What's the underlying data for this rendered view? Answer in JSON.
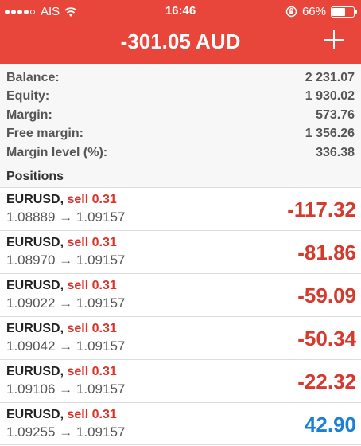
{
  "status_bar": {
    "carrier": "AIS",
    "time": "16:46",
    "battery": "66%",
    "battery_level": 0.66
  },
  "header": {
    "title": "-301.05 AUD",
    "add_icon": "plus-icon"
  },
  "summary": [
    {
      "label": "Balance:",
      "value": "2 231.07"
    },
    {
      "label": "Equity:",
      "value": "1 930.02"
    },
    {
      "label": "Margin:",
      "value": "573.76"
    },
    {
      "label": "Free margin:",
      "value": "1 356.26"
    },
    {
      "label": "Margin level (%):",
      "value": "336.38"
    }
  ],
  "positions_title": "Positions",
  "positions": [
    {
      "symbol": "EURUSD,",
      "type": "sell 0.31",
      "prices": "1.08889 → 1.09157",
      "profit": "-117.32",
      "color": "#d43b2f"
    },
    {
      "symbol": "EURUSD,",
      "type": "sell 0.31",
      "prices": "1.08970 → 1.09157",
      "profit": "-81.86",
      "color": "#d43b2f"
    },
    {
      "symbol": "EURUSD,",
      "type": "sell 0.31",
      "prices": "1.09022 → 1.09157",
      "profit": "-59.09",
      "color": "#d43b2f"
    },
    {
      "symbol": "EURUSD,",
      "type": "sell 0.31",
      "prices": "1.09042 → 1.09157",
      "profit": "-50.34",
      "color": "#d43b2f"
    },
    {
      "symbol": "EURUSD,",
      "type": "sell 0.31",
      "prices": "1.09106 → 1.09157",
      "profit": "-22.32",
      "color": "#d43b2f"
    },
    {
      "symbol": "EURUSD,",
      "type": "sell 0.31",
      "prices": "1.09255 → 1.09157",
      "profit": "42.90",
      "color": "#1a7fd8"
    }
  ],
  "colors": {
    "header_bg": "#e8463b",
    "loss": "#d43b2f",
    "gain": "#1a7fd8"
  }
}
